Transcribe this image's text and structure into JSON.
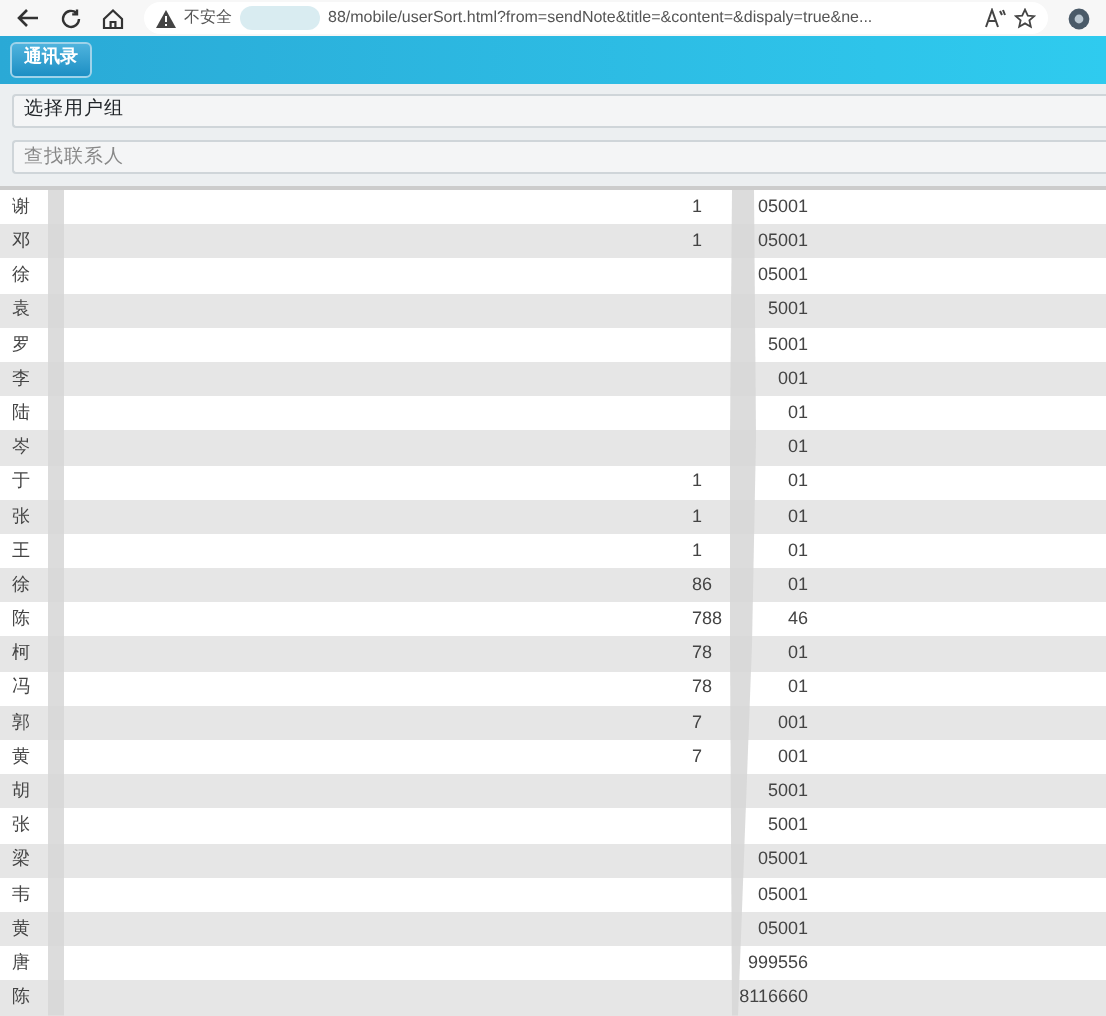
{
  "browser": {
    "security": "不安全",
    "url": "88/mobile/userSort.html?from=sendNote&title=&content=&dispaly=true&ne..."
  },
  "header": {
    "button": "通讯录"
  },
  "group_select": {
    "value": "选择用户组"
  },
  "search": {
    "placeholder": "查找联系人"
  },
  "contacts": [
    {
      "name": "谢",
      "phone_start": "1",
      "phone_end": "05001"
    },
    {
      "name": "邓",
      "phone_start": "1",
      "phone_end": "05001"
    },
    {
      "name": "徐",
      "phone_end": "05001"
    },
    {
      "name": "袁",
      "phone_end": "5001"
    },
    {
      "name": "罗",
      "phone_end": "5001"
    },
    {
      "name": "李",
      "phone_end": "001"
    },
    {
      "name": "陆",
      "phone_end": "01"
    },
    {
      "name": "岑",
      "phone_end": "01"
    },
    {
      "name": "于",
      "phone_start": "1",
      "phone_end": "01"
    },
    {
      "name": "张",
      "phone_start": "1",
      "phone_end": "01"
    },
    {
      "name": "王",
      "phone_start": "1",
      "phone_end": "01"
    },
    {
      "name": "徐",
      "phone_start": "86",
      "phone_end": "01"
    },
    {
      "name": "陈",
      "phone_start": "788",
      "phone_end": "46"
    },
    {
      "name": "柯",
      "phone_start": "78",
      "phone_end": "01"
    },
    {
      "name": "冯",
      "phone_start": "78",
      "phone_end": "01"
    },
    {
      "name": "郭",
      "phone_start": "7",
      "phone_end": "001"
    },
    {
      "name": "黄",
      "phone_start": "7",
      "phone_end": "001"
    },
    {
      "name": "胡",
      "phone_end": "5001"
    },
    {
      "name": "张",
      "phone_end": "5001"
    },
    {
      "name": "梁",
      "phone_end": "05001"
    },
    {
      "name": "韦",
      "phone_end": "05001"
    },
    {
      "name": "黄",
      "phone_end": "05001"
    },
    {
      "name": "唐",
      "phone_end": "999556"
    },
    {
      "name": "陈",
      "phone_end": "8116660"
    }
  ]
}
